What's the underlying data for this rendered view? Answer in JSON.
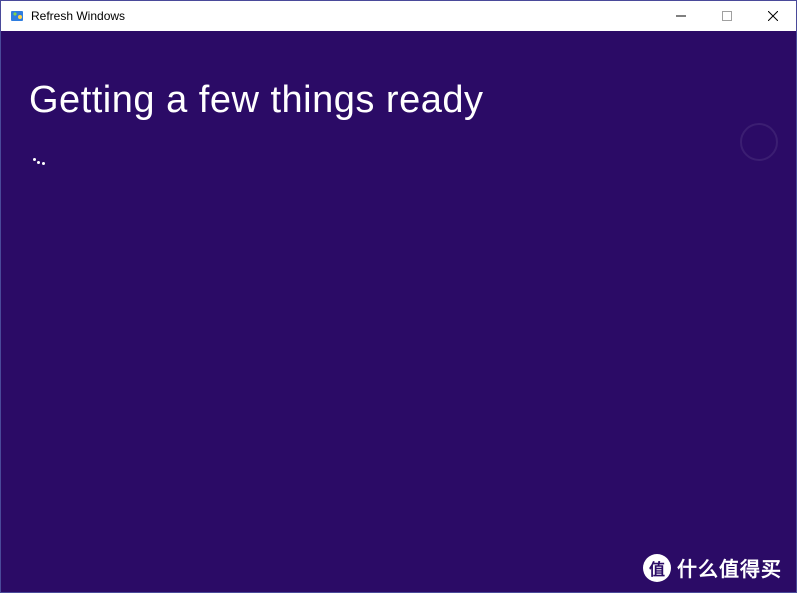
{
  "window": {
    "title": "Refresh Windows"
  },
  "content": {
    "heading": "Getting a few things ready"
  },
  "watermark": {
    "badge": "值",
    "text": "什么值得买"
  }
}
